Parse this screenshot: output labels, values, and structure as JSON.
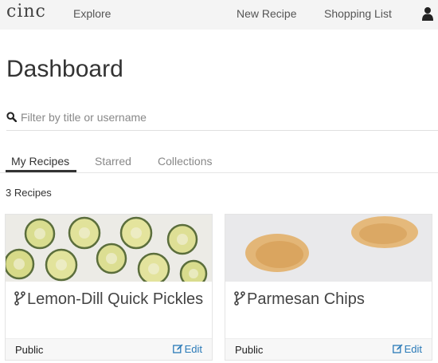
{
  "navbar": {
    "brand": "cinc",
    "explore": "Explore",
    "new_recipe": "New Recipe",
    "shopping_list": "Shopping List",
    "user_icon": "user-icon"
  },
  "page": {
    "title": "Dashboard"
  },
  "search": {
    "placeholder": "Filter by title or username",
    "value": "",
    "icon": "search-icon"
  },
  "tabs": [
    {
      "label": "My Recipes",
      "active": true
    },
    {
      "label": "Starred",
      "active": false
    },
    {
      "label": "Collections",
      "active": false
    }
  ],
  "recipes": {
    "count_label": "3 Recipes",
    "cards": [
      {
        "title": "Lemon-Dill Quick Pickles",
        "visibility": "Public",
        "edit_label": "Edit",
        "icon": "fork-icon"
      },
      {
        "title": "Parmesan Chips",
        "visibility": "Public",
        "edit_label": "Edit",
        "icon": "fork-icon"
      }
    ]
  },
  "colors": {
    "link": "#2a7ab8",
    "navbar_bg": "#f4f4f4",
    "footer_bg": "#f7f7f7"
  }
}
